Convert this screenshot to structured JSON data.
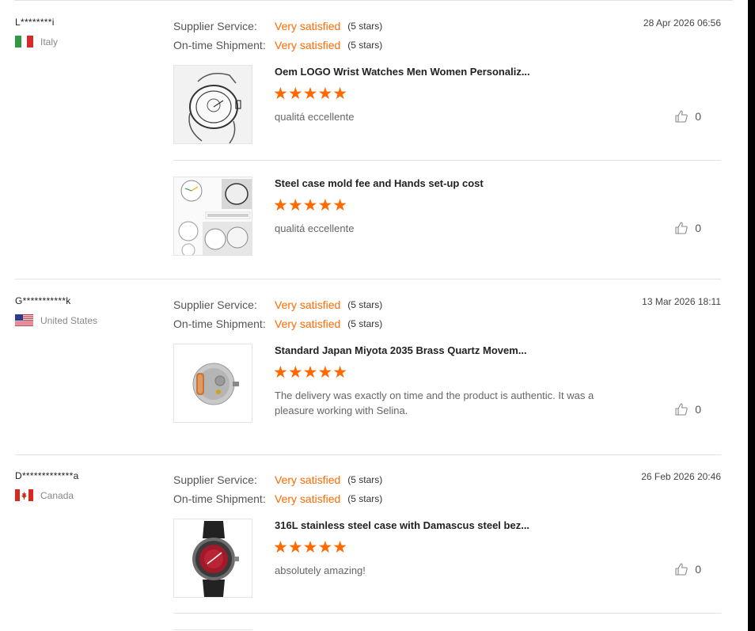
{
  "labels": {
    "supplier_service": "Supplier Service:",
    "ontime_shipment": "On-time Shipment:"
  },
  "reviews": [
    {
      "buyer": "L********i",
      "country": "Italy",
      "flag": "italy",
      "supplier_value": "Very satisfied",
      "supplier_stars": "(5 stars)",
      "shipment_value": "Very satisfied",
      "shipment_stars": "(5 stars)",
      "date": "28 Apr 2026 06:56",
      "products": [
        {
          "name": "Oem LOGO Wrist Watches Men Women Personaliz...",
          "stars": "★★★★★",
          "rating": 5,
          "comment": "qualitá eccellente",
          "likes": "0",
          "image": "watch-sketch"
        },
        {
          "name": "Steel case mold fee and Hands set-up cost",
          "stars": "★★★★★",
          "rating": 5,
          "comment": "qualitá eccellente",
          "likes": "0",
          "image": "watch-drawings"
        }
      ]
    },
    {
      "buyer": "G***********k",
      "country": "United States",
      "flag": "usa",
      "supplier_value": "Very satisfied",
      "supplier_stars": "(5 stars)",
      "shipment_value": "Very satisfied",
      "shipment_stars": "(5 stars)",
      "date": "13 Mar 2026 18:11",
      "products": [
        {
          "name": "Standard Japan Miyota 2035 Brass Quartz Movem...",
          "stars": "★★★★★",
          "rating": 5,
          "comment": "The delivery was exactly on time and the product is authentic.  It was a pleasure working with Selina.",
          "likes": "0",
          "image": "quartz-movement"
        }
      ]
    },
    {
      "buyer": "D*************a",
      "country": "Canada",
      "flag": "canada",
      "supplier_value": "Very satisfied",
      "supplier_stars": "(5 stars)",
      "shipment_value": "Very satisfied",
      "shipment_stars": "(5 stars)",
      "date": "26 Feb 2026 20:46",
      "products": [
        {
          "name": "316L stainless steel case with Damascus steel bez...",
          "stars": "★★★★★",
          "rating": 5,
          "comment": "absolutely amazing!",
          "likes": "0",
          "image": "red-dial-watch"
        }
      ]
    }
  ],
  "icons": {
    "like": "thumbs-up-icon"
  },
  "colors": {
    "accent": "#ff6a00"
  }
}
